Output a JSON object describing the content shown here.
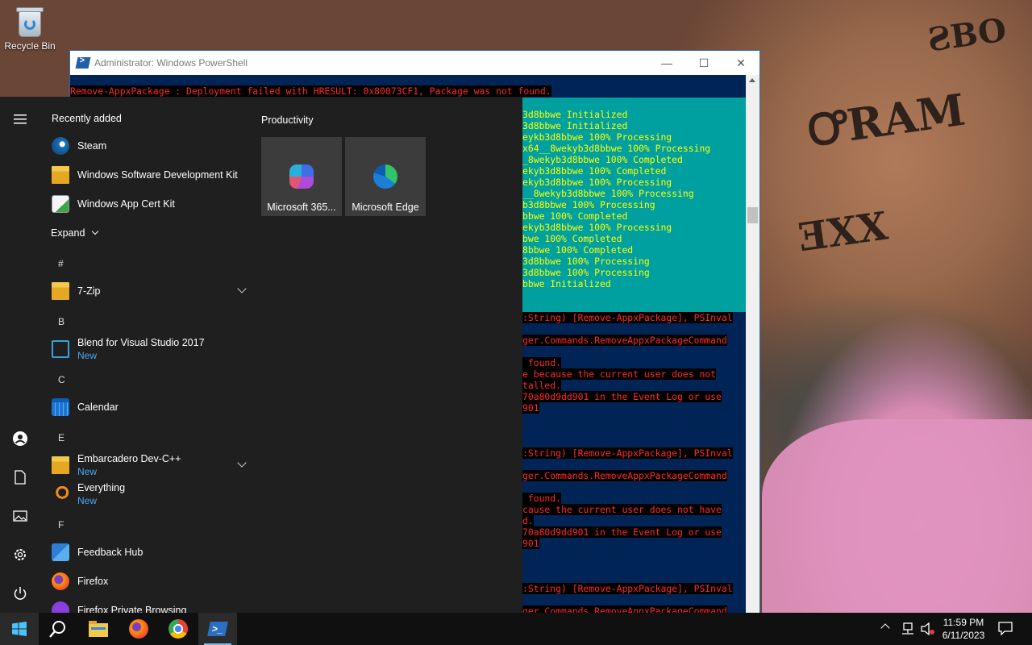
{
  "desktop": {
    "recycle_bin_label": "Recycle Bin"
  },
  "powershell": {
    "title": "Administrator: Windows PowerShell",
    "top_error": "Remove-AppxPackage : Deployment failed with HRESULT: 0x80073CF1, Package was not found.",
    "progress_lines": [
      "3d8bbwe Initialized",
      "3d8bbwe Initialized",
      "eykb3d8bbwe 100% Processing",
      "x64__8wekyb3d8bbwe 100% Processing",
      "_8wekyb3d8bbwe 100% Completed",
      "ekyb3d8bbwe 100% Completed",
      "ekyb3d8bbwe 100% Processing",
      "__8wekyb3d8bbwe 100% Processing",
      "b3d8bbwe 100% Processing",
      "bbwe 100% Completed",
      "ekyb3d8bbwe 100% Processing",
      "bwe 100% Completed",
      "8bbwe 100% Completed",
      "3d8bbwe 100% Processing",
      "3d8bbwe 100% Processing",
      "bbwe Initialized"
    ],
    "error_lines": [
      ":String) [Remove-AppxPackage], PSInval",
      "ger.Commands.RemoveAppxPackageCommand",
      " found.",
      "e because the current user does not",
      "talled.",
      "70a80d9dd901 in the Event Log or use",
      "901",
      ":String) [Remove-AppxPackage], PSInval",
      "ger.Commands.RemoveAppxPackageCommand",
      " found.",
      "cause the current user does not have",
      "d.",
      "70a80d9dd901 in the Event Log or use",
      "901",
      ":String) [Remove-AppxPackage], PSInval",
      "ger.Commands.RemoveAppxPackageCommand"
    ]
  },
  "start_menu": {
    "recently_added_title": "Recently added",
    "recent_apps": [
      {
        "label": "Steam",
        "icon": "steam-icon"
      },
      {
        "label": "Windows Software Development Kit",
        "icon": "folder-icon"
      },
      {
        "label": "Windows App Cert Kit",
        "icon": "cert-kit-icon"
      }
    ],
    "expand_label": "Expand",
    "letters": [
      "#",
      "B",
      "C",
      "E",
      "F"
    ],
    "apps": [
      {
        "label": "7-Zip",
        "sub": ""
      },
      {
        "label": "Blend for Visual Studio 2017",
        "sub": "New"
      },
      {
        "label": "Calendar",
        "sub": ""
      },
      {
        "label": "Embarcadero Dev-C++",
        "sub": "New"
      },
      {
        "label": "Everything",
        "sub": "New"
      },
      {
        "label": "Feedback Hub",
        "sub": ""
      },
      {
        "label": "Firefox",
        "sub": ""
      },
      {
        "label": "Firefox Private Browsing",
        "sub": ""
      }
    ],
    "tiles_group_title": "Productivity",
    "tiles": [
      {
        "label": "Microsoft 365...",
        "icon": "microsoft-365-icon"
      },
      {
        "label": "Microsoft Edge",
        "icon": "edge-icon"
      }
    ]
  },
  "taskbar": {
    "time": "11:59 PM",
    "date": "6/11/2023",
    "accent_color": "#76b9ed"
  }
}
